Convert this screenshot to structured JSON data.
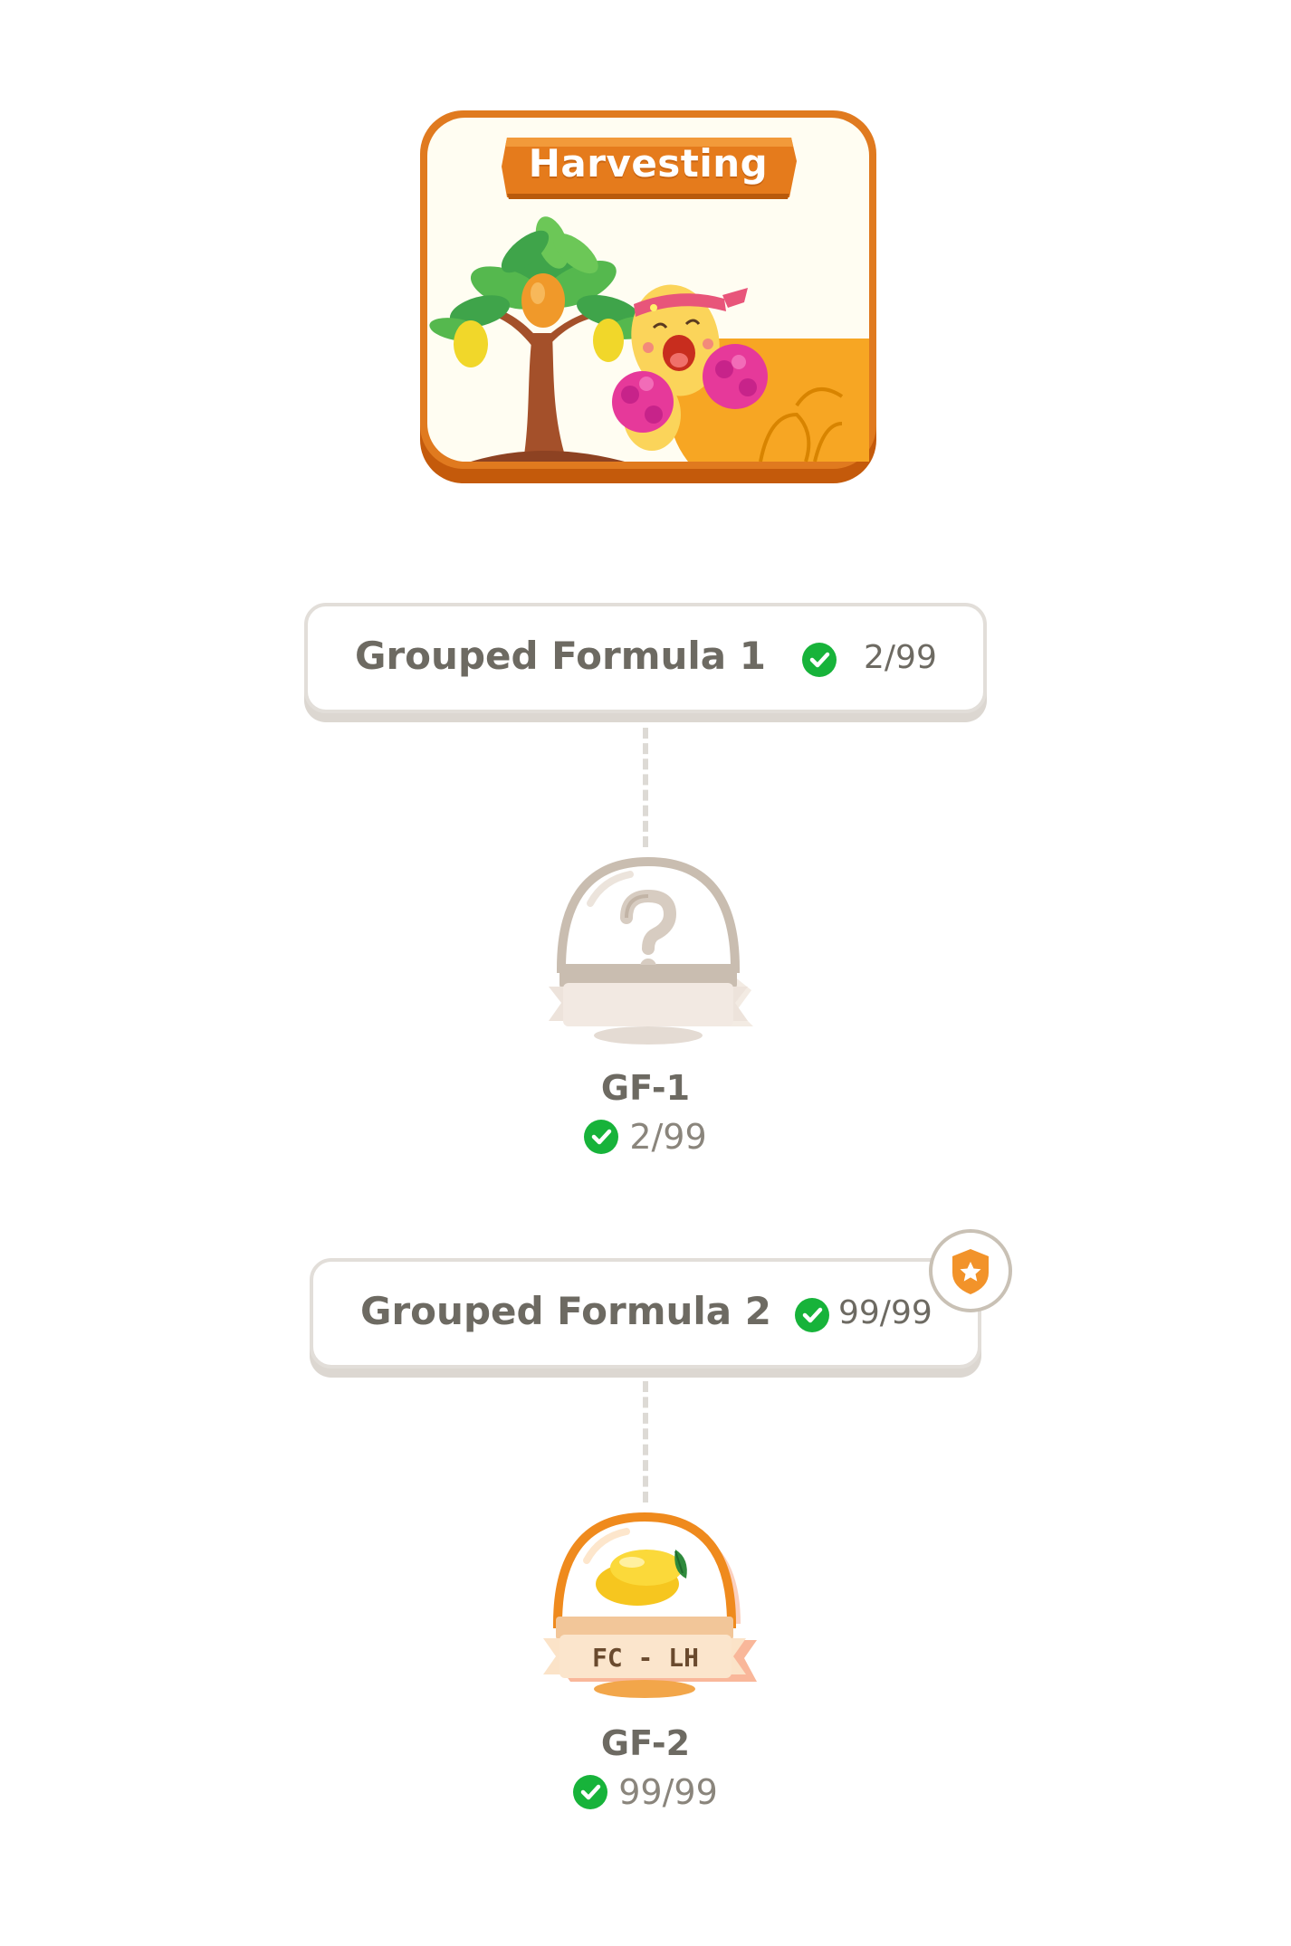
{
  "banner": {
    "title": "Harvesting"
  },
  "groups": [
    {
      "title": "Grouped Formula 1",
      "count": "2/99"
    },
    {
      "title": "Grouped Formula 2",
      "count": "99/99"
    }
  ],
  "nodes": [
    {
      "label": "GF-1",
      "count": "2/99",
      "locked": true
    },
    {
      "label": "GF-2",
      "count": "99/99",
      "ribbon": "FC - LH"
    }
  ],
  "colors": {
    "accent_orange": "#e8821e",
    "check_green": "#17b33a",
    "text_gray": "#6d6a62"
  },
  "icons": [
    "check-circle-icon",
    "shield-star-icon",
    "question-mark-icon",
    "mango-icon"
  ]
}
